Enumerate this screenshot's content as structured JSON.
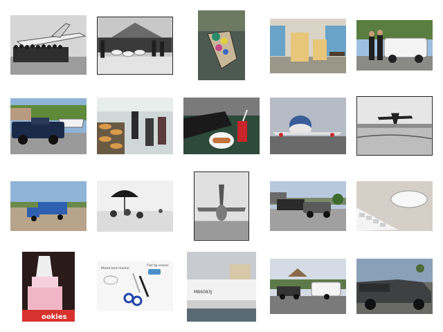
{
  "gallery": {
    "thumbnails": [
      {
        "subject": "airplane-crowd-bw",
        "tone": "grayscale"
      },
      {
        "subject": "sheep-and-crowd-bw",
        "tone": "grayscale"
      },
      {
        "subject": "people-in-boat",
        "tone": "color"
      },
      {
        "subject": "library-lounge-chairs",
        "tone": "color"
      },
      {
        "subject": "wedding-limousine",
        "tone": "color"
      },
      {
        "subject": "pickup-towing-boat",
        "tone": "color"
      },
      {
        "subject": "buffet-food-counter",
        "tone": "color"
      },
      {
        "subject": "hotdog-and-drink-on-table",
        "tone": "color"
      },
      {
        "subject": "jumbo-jet-on-runway",
        "tone": "color"
      },
      {
        "subject": "plane-over-beach-bw",
        "tone": "grayscale"
      },
      {
        "subject": "blue-three-wheel-truck",
        "tone": "color"
      },
      {
        "subject": "beach-umbrella-bw",
        "tone": "grayscale"
      },
      {
        "subject": "parked-airplane-bw",
        "tone": "grayscale"
      },
      {
        "subject": "truck-hauling-trailer",
        "tone": "color"
      },
      {
        "subject": "mouse-and-keyboard",
        "tone": "color"
      },
      {
        "subject": "cookie-shop-cake-window",
        "tone": "color"
      },
      {
        "subject": "scissors-and-markers",
        "tone": "color"
      },
      {
        "subject": "pontoon-boat",
        "tone": "color"
      },
      {
        "subject": "truck-towing-camper",
        "tone": "color"
      },
      {
        "subject": "gray-pickup-truck",
        "tone": "color"
      }
    ],
    "visible_text": {
      "shop_sign": "ookies",
      "boat_name": "MB6083J",
      "note_left": "Mixed text marker",
      "note_right": "Flat tip eraser"
    },
    "colors": {
      "sky_blue": "#8fb4d8",
      "grass_green": "#5f8a3a",
      "truck_blue": "#2f5fb0",
      "sign_red": "#d8322e"
    }
  }
}
